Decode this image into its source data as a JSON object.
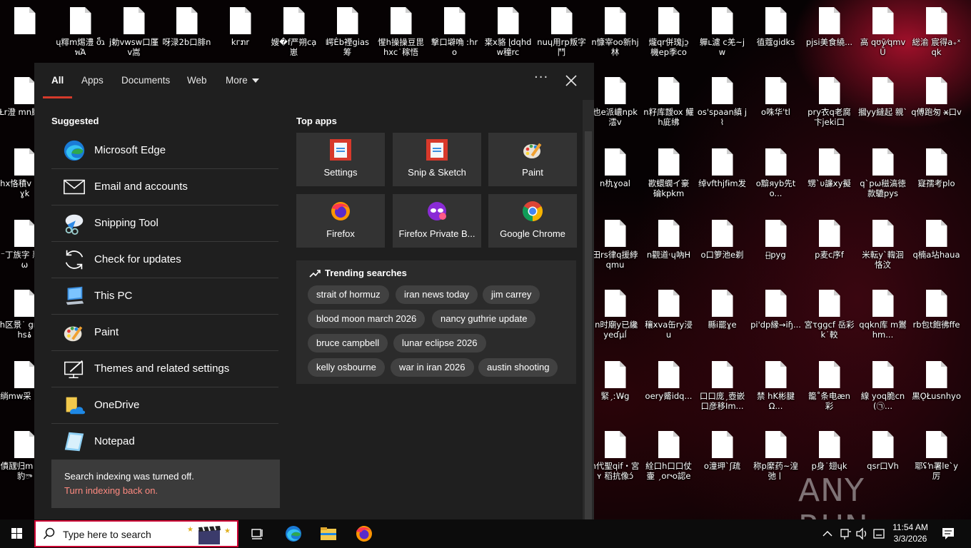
{
  "desktop": {
    "icon_labels": [
      [
        "",
        "ų䊫m焬澧\nơג็พἉ",
        "j勅vwsw口厪\nv嵩",
        "呀渌2b口腓n",
        "kгກr",
        "嫂�f严朔cạ\n崽",
        "崿Ėb禋gias\n筹",
        "惺h操操豆毘\nhxc˙稼悟",
        "撃口壀唃\nːhro",
        "枽x貉\nɭdqhdw穜rc",
        "nuɥ用rp叛字\n鬥",
        "n慷宰oo新hj\n林",
        "爖qr併瑰jɔ̤\n機ep季co",
        "軃ʟ濾\nc羌~jw",
        "徝蔻gidks",
        "pjsi美食繞...",
        "高\nqʊӯ⁄qmvŰ",
        "総渝\n宸得a₊ˣqk"
      ],
      [
        "Ɫr澄\nmn颳ౄ",
        "",
        "",
        "",
        "",
        "",
        "",
        "",
        "",
        "",
        "",
        "也е派嶩npk\n澐v",
        "n籽库靉ox\n鱹h庛绋",
        "os'spaan縝\nj⌇",
        "o咮华ˈtl",
        "pry衣q老腐\n卞jeki口",
        "摑yy繨起\n親ˋ",
        "q傅跑匆\nx̶口v",
        ""
      ],
      [
        "hx恪積v\n∞孺ɣk",
        "",
        "",
        "",
        "",
        "",
        "",
        "",
        "",
        "",
        "",
        "n朹ɣoal",
        "歁蠉繝イ豪\n碖kpkm",
        "绰vfthjfɨm发",
        "o黭яyb先to...",
        "甥ˋυ譧x̷y擬",
        "q`pω稵滈徳\n款騼pys",
        "寲孺考plo"
      ],
      [
        "⁻丁族字\n惡據ω",
        "",
        "",
        "",
        "",
        "",
        "",
        "",
        "",
        "",
        "",
        "田rs律q援綍\nqmu",
        "n觀道˓ɥ吶H",
        "o口箩池e剃",
        "计̶pyg",
        "p麦c序f",
        "米転yˋ輷洄\n恪汶",
        "q楠a坫haua"
      ],
      [
        "h区景˙\ngmmhsۂ",
        "",
        "",
        "",
        "",
        "",
        "",
        "",
        "",
        "",
        "",
        "İn时廟y已纔\nyeɗμĺ",
        "穰xva缶ry浸\nu",
        "縣i罷ɣe",
        "pi'dp縁→iɧ...",
        "宮τggcf\n岳彩k˙較",
        "qqkn库\nm鸑hm...",
        "rb包t飽彿ffe"
      ],
      [
        "绱mw采\n絣kj",
        "",
        "",
        "",
        "",
        "",
        "",
        "",
        "",
        "",
        "",
        "緊ˏːW̵g",
        "oery觱idq...",
        "口口庞ˏ壺嵌\n口彦移Im...",
        "禁\nhK彬腱Ω...",
        "籠˚条电æn\n彩",
        "線\nyoq脆cn(㉠...",
        "黒ǪŁusnhyo"
      ],
      [
        "債瓼归m\n窴x豹ా",
        "",
        "",
        "",
        "",
        "",
        "",
        "",
        "",
        "",
        "",
        "n代聖qif・宮ʏ\n稻抗像ɔ́",
        "絟口h口口仗壷\nˏor˞ᴏ認e",
        "o潼玾ˋʃ疏",
        "称p縻药~湟\n弛ㅣ",
        "p身˙翅ɥk",
        "qsr口Vh",
        "耶ʢŉ署lɐ`y\n厉"
      ]
    ],
    "first_icon_label": ""
  },
  "search_panel": {
    "tabs": [
      {
        "label": "All",
        "active": true
      },
      {
        "label": "Apps"
      },
      {
        "label": "Documents"
      },
      {
        "label": "Web"
      },
      {
        "label": "More"
      }
    ],
    "options_label": "···",
    "suggested_title": "Suggested",
    "suggested": [
      {
        "label": "Microsoft Edge",
        "icon": "edge-icon"
      },
      {
        "label": "Email and accounts",
        "icon": "mail-icon"
      },
      {
        "label": "Snipping Tool",
        "icon": "snipping-tool-icon"
      },
      {
        "label": "Check for updates",
        "icon": "sync-icon"
      },
      {
        "label": "This PC",
        "icon": "computer-icon"
      },
      {
        "label": "Paint",
        "icon": "paint-icon"
      },
      {
        "label": "Themes and related settings",
        "icon": "themes-icon"
      },
      {
        "label": "OneDrive",
        "icon": "onedrive-icon"
      },
      {
        "label": "Notepad",
        "icon": "notepad-icon"
      }
    ],
    "notice": {
      "message": "Search indexing was turned off.",
      "link": "Turn indexing back on."
    },
    "top_apps_title": "Top apps",
    "top_apps": [
      {
        "label": "Settings",
        "icon": "settings-icon"
      },
      {
        "label": "Snip & Sketch",
        "icon": "snip-sketch-icon"
      },
      {
        "label": "Paint",
        "icon": "paint-icon"
      },
      {
        "label": "Firefox",
        "icon": "firefox-icon"
      },
      {
        "label": "Firefox Private B...",
        "icon": "firefox-private-icon"
      },
      {
        "label": "Google Chrome",
        "icon": "chrome-icon"
      }
    ],
    "trending_title": "Trending searches",
    "trending": [
      "strait of hormuz",
      "iran news today",
      "jim carrey",
      "blood moon march 2026",
      "nancy guthrie update",
      "bruce campbell",
      "lunar eclipse 2026",
      "kelly osbourne",
      "war in iran 2026",
      "austin shooting"
    ]
  },
  "taskbar": {
    "search_placeholder": "Type here to search",
    "time": "11:54 AM",
    "date": "3/3/2026"
  },
  "watermark": {
    "text": "ANY RUN"
  },
  "colors": {
    "accent": "#d53a2b",
    "panel_bg": "#1f1f1f",
    "tile_bg": "#333333",
    "link": "#ff8a80"
  }
}
